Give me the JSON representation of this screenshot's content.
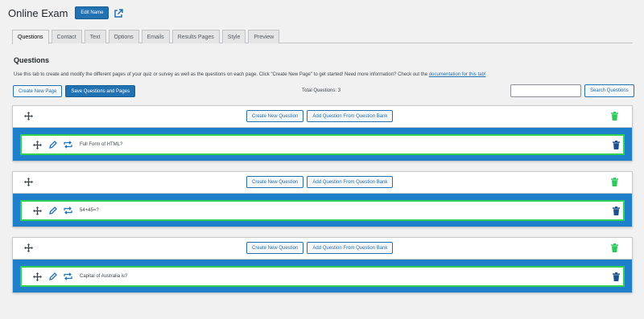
{
  "header": {
    "title": "Online Exam",
    "edit_name_label": "Edit Name",
    "external_link_icon": "external-link-icon"
  },
  "tabs": [
    {
      "label": "Questions",
      "active": true
    },
    {
      "label": "Contact",
      "active": false
    },
    {
      "label": "Text",
      "active": false
    },
    {
      "label": "Options",
      "active": false
    },
    {
      "label": "Emails",
      "active": false
    },
    {
      "label": "Results Pages",
      "active": false
    },
    {
      "label": "Style",
      "active": false
    },
    {
      "label": "Preview",
      "active": false
    }
  ],
  "questions_section": {
    "heading": "Questions",
    "description": "Use this tab to create and modify the different pages of your quiz or survey as well as the questions on each page. Click \"Create New Page\" to get started! Need more information? Check out the ",
    "doc_link": "documentation for this tab!",
    "create_page_label": "Create New Page",
    "save_label": "Save Questions and Pages",
    "total_label": "Total Questions: 3",
    "search_placeholder": "",
    "search_button": "Search Questions"
  },
  "pages": [
    {
      "create_question_label": "Create New Question",
      "bank_label": "Add Question From Question Bank",
      "question": "Full Form of HTML?"
    },
    {
      "create_question_label": "Create New Question",
      "bank_label": "Add Question From Question Bank",
      "question": "54+45=?"
    },
    {
      "create_question_label": "Create New Question",
      "bank_label": "Add Question From Question Bank",
      "question": "Capital of Australia is?"
    }
  ],
  "colors": {
    "primary": "#2271b1",
    "question_area": "#1e7fcb",
    "question_border": "#30d24f",
    "trash_green": "#2fc95b",
    "trash_blue": "#1d4f91"
  },
  "icons": [
    "move-icon",
    "edit-icon",
    "duplicate-icon",
    "trash-icon"
  ]
}
